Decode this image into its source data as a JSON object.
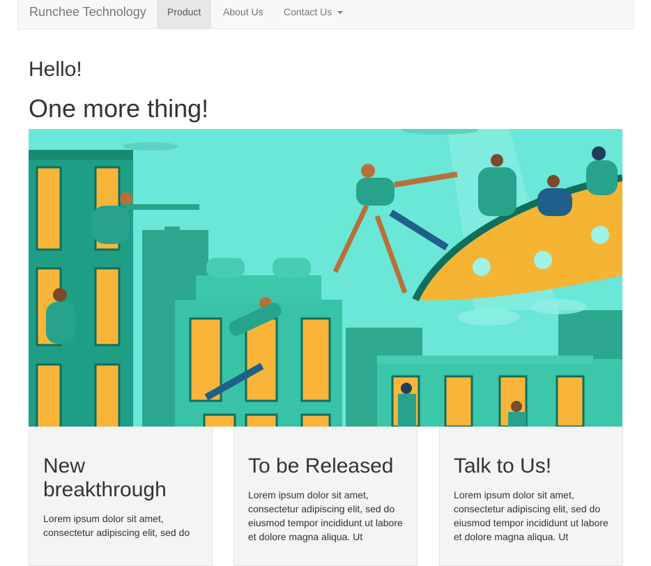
{
  "navbar": {
    "brand": "Runchee Technology",
    "items": [
      {
        "label": "Product",
        "active": true
      },
      {
        "label": "About Us",
        "active": false
      },
      {
        "label": "Contact Us",
        "active": false,
        "dropdown": true
      }
    ]
  },
  "hero": {
    "greeting": "Hello!",
    "tagline": "One more thing!",
    "illustration": "city-rooftops-flying-saucer-illustration"
  },
  "cards": [
    {
      "title": "New breakthrough",
      "body": "Lorem ipsum dolor sit amet, consectetur adipiscing elit, sed do"
    },
    {
      "title": "To be Released",
      "body": "Lorem ipsum dolor sit amet, consectetur adipiscing elit, sed do eiusmod tempor incididunt ut labore et dolore magna aliqua. Ut"
    },
    {
      "title": "Talk to Us!",
      "body": "Lorem ipsum dolor sit amet, consectetur adipiscing elit, sed do eiusmod tempor incididunt ut labore et dolore magna aliqua. Ut"
    }
  ],
  "colors": {
    "sky": "#6ae7d6",
    "building_dark": "#1f9e86",
    "building_mid": "#2fb59a",
    "window": "#f8b53a",
    "saucer": "#f5b433",
    "card_bg": "#f4f4f4"
  }
}
